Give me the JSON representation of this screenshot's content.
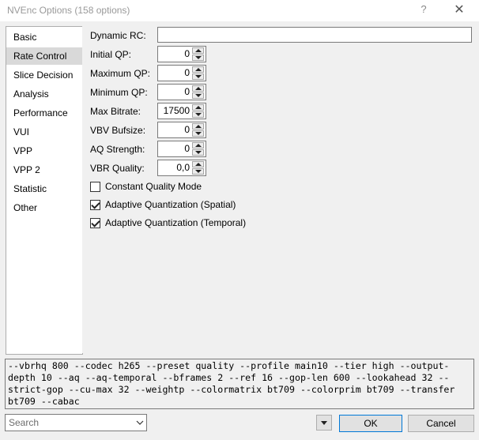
{
  "window": {
    "title": "NVEnc Options (158 options)",
    "help_glyph": "?",
    "close_glyph": "✕"
  },
  "sidebar": {
    "items": [
      {
        "label": "Basic",
        "selected": false
      },
      {
        "label": "Rate Control",
        "selected": true
      },
      {
        "label": "Slice Decision",
        "selected": false
      },
      {
        "label": "Analysis",
        "selected": false
      },
      {
        "label": "Performance",
        "selected": false
      },
      {
        "label": "VUI",
        "selected": false
      },
      {
        "label": "VPP",
        "selected": false
      },
      {
        "label": "VPP 2",
        "selected": false
      },
      {
        "label": "Statistic",
        "selected": false
      },
      {
        "label": "Other",
        "selected": false
      }
    ]
  },
  "rate_control": {
    "dynamic_rc": {
      "label": "Dynamic RC:",
      "value": ""
    },
    "initial_qp": {
      "label": "Initial QP:",
      "value": "0"
    },
    "maximum_qp": {
      "label": "Maximum QP:",
      "value": "0"
    },
    "minimum_qp": {
      "label": "Minimum QP:",
      "value": "0"
    },
    "max_bitrate": {
      "label": "Max Bitrate:",
      "value": "17500"
    },
    "vbv_bufsize": {
      "label": "VBV Bufsize:",
      "value": "0"
    },
    "aq_strength": {
      "label": "AQ Strength:",
      "value": "0"
    },
    "vbr_quality": {
      "label": "VBR Quality:",
      "value": "0,0"
    },
    "constant_quality_mode": {
      "label": "Constant Quality Mode",
      "checked": false
    },
    "aq_spatial": {
      "label": "Adaptive Quantization (Spatial)",
      "checked": true
    },
    "aq_temporal": {
      "label": "Adaptive Quantization (Temporal)",
      "checked": true
    }
  },
  "command_line": "--vbrhq 800 --codec h265 --preset quality --profile main10 --tier high --output-depth 10 --aq --aq-temporal --bframes 2 --ref 16 --gop-len 600 --lookahead 32 --strict-gop --cu-max 32 --weightp --colormatrix bt709 --colorprim bt709 --transfer bt709 --cabac",
  "footer": {
    "search_placeholder": "Search",
    "ok_label": "OK",
    "cancel_label": "Cancel"
  },
  "icons": {
    "close": "close-icon",
    "help": "help-icon",
    "spin_up": "triangle-up-icon",
    "spin_down": "triangle-down-icon",
    "chevron": "chevron-down-icon",
    "check": "checkmark-icon"
  },
  "colors": {
    "accent": "#0078d7",
    "selected_item": "#d9d9d9",
    "title_text": "#999999"
  }
}
